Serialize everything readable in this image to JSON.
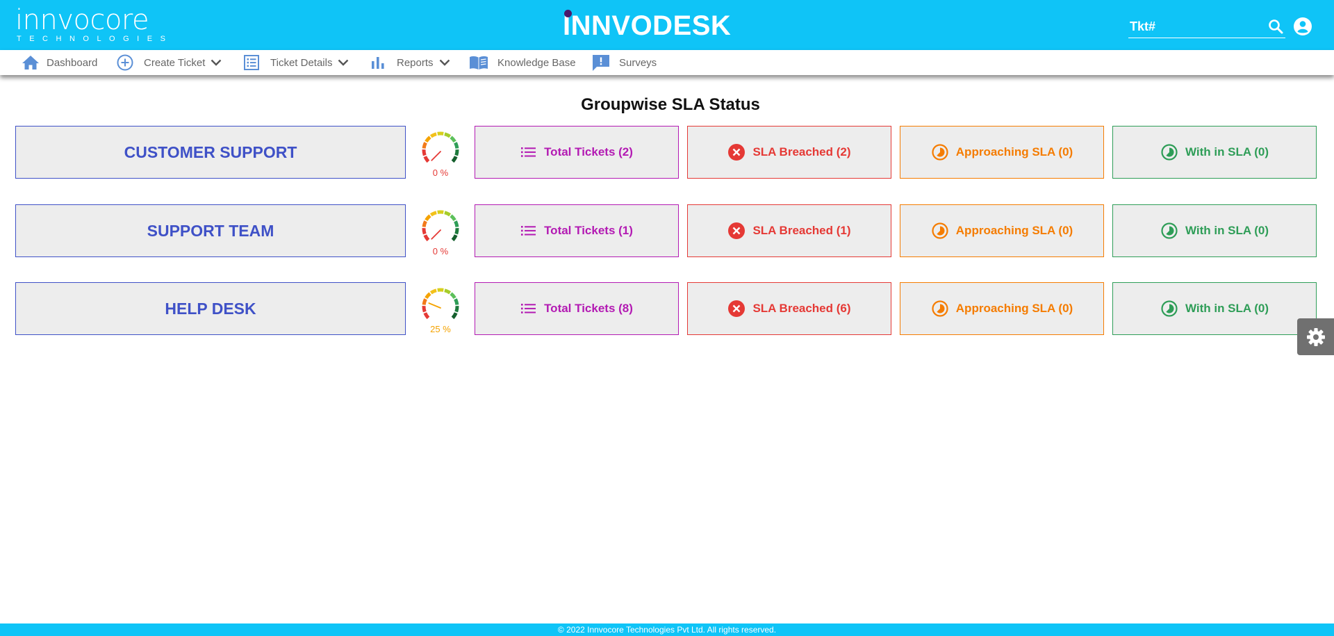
{
  "header": {
    "logo_left": "innvocore",
    "logo_left_sub": "TECHNOLOGIES",
    "logo_center": "INNVODESK",
    "search_placeholder": "Tkt#",
    "search_value": ""
  },
  "nav": {
    "items": [
      {
        "label": "Dashboard",
        "icon": "home-icon"
      },
      {
        "label": "Create Ticket",
        "icon": "add-circle-icon",
        "dropdown": true
      },
      {
        "label": "Ticket Details",
        "icon": "list-icon",
        "dropdown": true
      },
      {
        "label": "Reports",
        "icon": "bar-chart-icon",
        "dropdown": true
      },
      {
        "label": "Knowledge Base",
        "icon": "book-icon"
      },
      {
        "label": "Surveys",
        "icon": "feedback-icon"
      }
    ]
  },
  "page": {
    "title": "Groupwise SLA Status"
  },
  "groups": [
    {
      "name": "CUSTOMER SUPPORT",
      "percent": 0,
      "percent_label": "0 %",
      "total": "Total Tickets (2)",
      "breached": "SLA Breached (2)",
      "approaching": "Approaching SLA (0)",
      "within": "With in SLA (0)"
    },
    {
      "name": "SUPPORT TEAM",
      "percent": 0,
      "percent_label": "0 %",
      "total": "Total Tickets (1)",
      "breached": "SLA Breached (1)",
      "approaching": "Approaching SLA (0)",
      "within": "With in SLA (0)"
    },
    {
      "name": "HELP DESK",
      "percent": 25,
      "percent_label": "25 %",
      "total": "Total Tickets (8)",
      "breached": "SLA Breached (6)",
      "approaching": "Approaching SLA (0)",
      "within": "With in SLA (0)"
    }
  ],
  "colors": {
    "brand": "#0fc4f7",
    "group": "#3f51c7",
    "total": "#b31ab3",
    "breached": "#e53935",
    "approaching": "#f57c00",
    "within": "#2e9d57",
    "gauge_low": "#e53935",
    "gauge_mid": "#f5a300"
  },
  "footer": {
    "text": "© 2022 Innvocore Technologies Pvt Ltd. All rights reserved."
  }
}
